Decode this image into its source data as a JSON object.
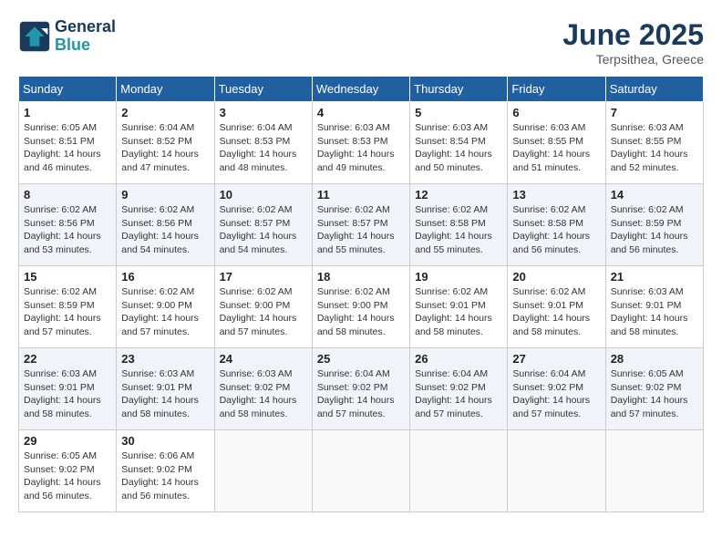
{
  "header": {
    "logo_line1": "General",
    "logo_line2": "Blue",
    "month_title": "June 2025",
    "location": "Terpsithea, Greece"
  },
  "weekdays": [
    "Sunday",
    "Monday",
    "Tuesday",
    "Wednesday",
    "Thursday",
    "Friday",
    "Saturday"
  ],
  "weeks": [
    [
      {
        "day": "1",
        "sunrise": "Sunrise: 6:05 AM",
        "sunset": "Sunset: 8:51 PM",
        "daylight": "Daylight: 14 hours and 46 minutes."
      },
      {
        "day": "2",
        "sunrise": "Sunrise: 6:04 AM",
        "sunset": "Sunset: 8:52 PM",
        "daylight": "Daylight: 14 hours and 47 minutes."
      },
      {
        "day": "3",
        "sunrise": "Sunrise: 6:04 AM",
        "sunset": "Sunset: 8:53 PM",
        "daylight": "Daylight: 14 hours and 48 minutes."
      },
      {
        "day": "4",
        "sunrise": "Sunrise: 6:03 AM",
        "sunset": "Sunset: 8:53 PM",
        "daylight": "Daylight: 14 hours and 49 minutes."
      },
      {
        "day": "5",
        "sunrise": "Sunrise: 6:03 AM",
        "sunset": "Sunset: 8:54 PM",
        "daylight": "Daylight: 14 hours and 50 minutes."
      },
      {
        "day": "6",
        "sunrise": "Sunrise: 6:03 AM",
        "sunset": "Sunset: 8:55 PM",
        "daylight": "Daylight: 14 hours and 51 minutes."
      },
      {
        "day": "7",
        "sunrise": "Sunrise: 6:03 AM",
        "sunset": "Sunset: 8:55 PM",
        "daylight": "Daylight: 14 hours and 52 minutes."
      }
    ],
    [
      {
        "day": "8",
        "sunrise": "Sunrise: 6:02 AM",
        "sunset": "Sunset: 8:56 PM",
        "daylight": "Daylight: 14 hours and 53 minutes."
      },
      {
        "day": "9",
        "sunrise": "Sunrise: 6:02 AM",
        "sunset": "Sunset: 8:56 PM",
        "daylight": "Daylight: 14 hours and 54 minutes."
      },
      {
        "day": "10",
        "sunrise": "Sunrise: 6:02 AM",
        "sunset": "Sunset: 8:57 PM",
        "daylight": "Daylight: 14 hours and 54 minutes."
      },
      {
        "day": "11",
        "sunrise": "Sunrise: 6:02 AM",
        "sunset": "Sunset: 8:57 PM",
        "daylight": "Daylight: 14 hours and 55 minutes."
      },
      {
        "day": "12",
        "sunrise": "Sunrise: 6:02 AM",
        "sunset": "Sunset: 8:58 PM",
        "daylight": "Daylight: 14 hours and 55 minutes."
      },
      {
        "day": "13",
        "sunrise": "Sunrise: 6:02 AM",
        "sunset": "Sunset: 8:58 PM",
        "daylight": "Daylight: 14 hours and 56 minutes."
      },
      {
        "day": "14",
        "sunrise": "Sunrise: 6:02 AM",
        "sunset": "Sunset: 8:59 PM",
        "daylight": "Daylight: 14 hours and 56 minutes."
      }
    ],
    [
      {
        "day": "15",
        "sunrise": "Sunrise: 6:02 AM",
        "sunset": "Sunset: 8:59 PM",
        "daylight": "Daylight: 14 hours and 57 minutes."
      },
      {
        "day": "16",
        "sunrise": "Sunrise: 6:02 AM",
        "sunset": "Sunset: 9:00 PM",
        "daylight": "Daylight: 14 hours and 57 minutes."
      },
      {
        "day": "17",
        "sunrise": "Sunrise: 6:02 AM",
        "sunset": "Sunset: 9:00 PM",
        "daylight": "Daylight: 14 hours and 57 minutes."
      },
      {
        "day": "18",
        "sunrise": "Sunrise: 6:02 AM",
        "sunset": "Sunset: 9:00 PM",
        "daylight": "Daylight: 14 hours and 58 minutes."
      },
      {
        "day": "19",
        "sunrise": "Sunrise: 6:02 AM",
        "sunset": "Sunset: 9:01 PM",
        "daylight": "Daylight: 14 hours and 58 minutes."
      },
      {
        "day": "20",
        "sunrise": "Sunrise: 6:02 AM",
        "sunset": "Sunset: 9:01 PM",
        "daylight": "Daylight: 14 hours and 58 minutes."
      },
      {
        "day": "21",
        "sunrise": "Sunrise: 6:03 AM",
        "sunset": "Sunset: 9:01 PM",
        "daylight": "Daylight: 14 hours and 58 minutes."
      }
    ],
    [
      {
        "day": "22",
        "sunrise": "Sunrise: 6:03 AM",
        "sunset": "Sunset: 9:01 PM",
        "daylight": "Daylight: 14 hours and 58 minutes."
      },
      {
        "day": "23",
        "sunrise": "Sunrise: 6:03 AM",
        "sunset": "Sunset: 9:01 PM",
        "daylight": "Daylight: 14 hours and 58 minutes."
      },
      {
        "day": "24",
        "sunrise": "Sunrise: 6:03 AM",
        "sunset": "Sunset: 9:02 PM",
        "daylight": "Daylight: 14 hours and 58 minutes."
      },
      {
        "day": "25",
        "sunrise": "Sunrise: 6:04 AM",
        "sunset": "Sunset: 9:02 PM",
        "daylight": "Daylight: 14 hours and 57 minutes."
      },
      {
        "day": "26",
        "sunrise": "Sunrise: 6:04 AM",
        "sunset": "Sunset: 9:02 PM",
        "daylight": "Daylight: 14 hours and 57 minutes."
      },
      {
        "day": "27",
        "sunrise": "Sunrise: 6:04 AM",
        "sunset": "Sunset: 9:02 PM",
        "daylight": "Daylight: 14 hours and 57 minutes."
      },
      {
        "day": "28",
        "sunrise": "Sunrise: 6:05 AM",
        "sunset": "Sunset: 9:02 PM",
        "daylight": "Daylight: 14 hours and 57 minutes."
      }
    ],
    [
      {
        "day": "29",
        "sunrise": "Sunrise: 6:05 AM",
        "sunset": "Sunset: 9:02 PM",
        "daylight": "Daylight: 14 hours and 56 minutes."
      },
      {
        "day": "30",
        "sunrise": "Sunrise: 6:06 AM",
        "sunset": "Sunset: 9:02 PM",
        "daylight": "Daylight: 14 hours and 56 minutes."
      },
      null,
      null,
      null,
      null,
      null
    ]
  ]
}
